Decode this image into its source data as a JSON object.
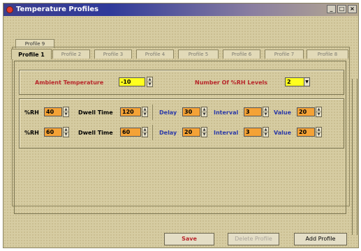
{
  "window": {
    "title": "Temperature Profiles",
    "icon": "app-dot-icon"
  },
  "tabs": {
    "back_row": [
      "Profile 9"
    ],
    "front_row": [
      "Profile 1",
      "Profile 2",
      "Profile 3",
      "Profile 4",
      "Profile 5",
      "Profile 6",
      "Profile 7",
      "Profile 8"
    ],
    "active": "Profile 1"
  },
  "ambient": {
    "temp_label": "Ambient Temperature",
    "temp_value": "-10",
    "levels_label": "Number Of %RH Levels",
    "levels_value": "2"
  },
  "rows": [
    {
      "rh_label": "%RH",
      "rh_value": "40",
      "dwell_label": "Dwell Time",
      "dwell_value": "120",
      "delay_label": "Delay",
      "delay_value": "30",
      "interval_label": "Interval",
      "interval_value": "3",
      "value_label": "Value",
      "value_value": "20"
    },
    {
      "rh_label": "%RH",
      "rh_value": "60",
      "dwell_label": "Dwell Time",
      "dwell_value": "60",
      "delay_label": "Delay",
      "delay_value": "20",
      "interval_label": "Interval",
      "interval_value": "3",
      "value_label": "Value",
      "value_value": "20"
    }
  ],
  "buttons": {
    "save": "Save",
    "delete": "Delete Profile",
    "add": "Add Profile"
  },
  "colors": {
    "field_yellow": "#ffff1e",
    "field_orange": "#f4a236",
    "label_red": "#b8262a",
    "label_blue": "#2c3aa8"
  }
}
